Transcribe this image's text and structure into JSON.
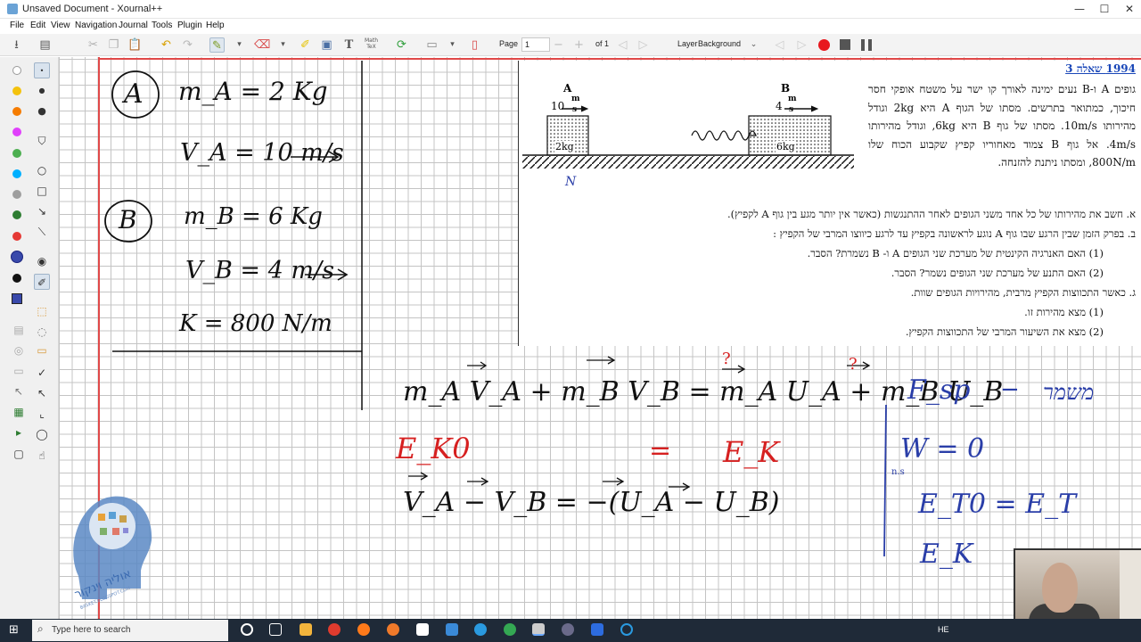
{
  "window": {
    "title": "Unsaved Document - Xournal++",
    "minimize": "—",
    "maximize": "☐",
    "close": "✕"
  },
  "menu": [
    "File",
    "Edit",
    "View",
    "Navigation",
    "Journal",
    "Tools",
    "Plugin",
    "Help"
  ],
  "toolbar": {
    "page_label": "Page",
    "page_value": "1",
    "page_total": "of 1",
    "layer_label": "Layer",
    "layer_value": "Background",
    "math_tex": "Math\nTeX",
    "text_tool": "T"
  },
  "palette_colors": [
    "#ffffff",
    "#f4c20d",
    "#f57c00",
    "#e040fb",
    "#4caf50",
    "#00b0ff",
    "#9e9e9e",
    "#2e7d32",
    "#e53935",
    "#3949ab",
    "#111111"
  ],
  "handwriting": {
    "left_panel": {
      "body_a": "A",
      "mass_a": "m_A = 2 Kg",
      "vel_a": "V_A = 10 m/s",
      "body_b": "B",
      "mass_b": "m_B = 6 Kg",
      "vel_b": "V_B = 4 m/s",
      "spring_k": "K = 800 N/m"
    },
    "momentum_eq": "m_A V_A + m_B V_B = m_A U_A + m_B U_B",
    "energy_eq_left": "E_K0",
    "energy_eq_mid": "=",
    "energy_eq_right": "E_K",
    "velocity_eq": "V_A − V_B = −(U_A − U_B)",
    "right_notes": {
      "fsp": "F_sp",
      "dash": "−",
      "conserved": "משמר",
      "work": "W = 0",
      "ws_label": "n.s",
      "energy": "E_T0 = E_T",
      "ek": "E_K"
    },
    "question_marks": "?"
  },
  "problem": {
    "title": "1994 שאלה 3",
    "intro": "גופים A ו-B נעים ימינה לאורך קו ישר על משטח אופקי חסר חיכוך, כמתואר בתרשים. מסתו של הגוף A היא 2kg וגודל מהירותו 10m/s. מסתו של גוף B היא 6kg, וגודל מהירותו 4m/s. אל גוף B צמוד מאחוריו קפיץ שקבוע הכוח שלו 800N/m, ומסתו ניתנת להזנחה.",
    "items": [
      "א.  חשב את מהירותו של כל אחד משני הגופים לאחר ההתנגשות (כאשר אין יותר מגע בין גוף A לקפיץ).",
      "ב.  בפרק הזמן שבין הרגע שבו גוף A נוגע לראשונה בקפיץ עד לרגע כיווצו המרבי של הקפיץ :",
      "(1)  האם האנרגיה הקינטית של מערכת שני הגופים A ו- B נשמרת?  הסבר.",
      "(2)  האם התנע של מערכת שני הגופים נשמר?  הסבר.",
      "ג.  כאשר התכווצות הקפיץ מרבית, מהירויות הגופים שוות.",
      "(1)  מצא מהירות זו.",
      "(2)  מצא את השיעור המרבי של התכווצות הקפיץ."
    ],
    "diagram": {
      "label_a": "A",
      "speed_a": "10",
      "label_b": "B",
      "speed_b": "4",
      "unit_top": "m",
      "unit_bottom": "s",
      "mass_a": "2kg",
      "mass_b": "6kg",
      "normal_label": "N"
    }
  },
  "logo": {
    "text": "אוליה וינקור",
    "site": "BASKET.BLOGSPOT.COM"
  },
  "taskbar": {
    "search_placeholder": "Type here to search",
    "lang": "HE"
  }
}
